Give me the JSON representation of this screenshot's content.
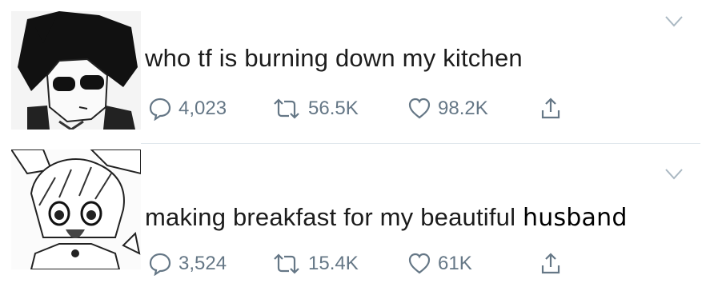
{
  "tweets": [
    {
      "text": "who tf is burning down my kitchen",
      "edited_word": "",
      "replies": "4,023",
      "retweets": "56.5K",
      "likes": "98.2K"
    },
    {
      "text": "making breakfast for my beautiful ",
      "edited_word": "husband",
      "replies": "3,524",
      "retweets": "15.4K",
      "likes": "61K"
    }
  ],
  "icons": {
    "reply": "speech-bubble-icon",
    "retweet": "retweet-arrows-icon",
    "like": "heart-icon",
    "share": "share-upload-icon",
    "caret": "chevron-down-icon"
  },
  "colors": {
    "text": "#1c1c1c",
    "meta": "#657786",
    "divider": "#e1e8ed"
  }
}
